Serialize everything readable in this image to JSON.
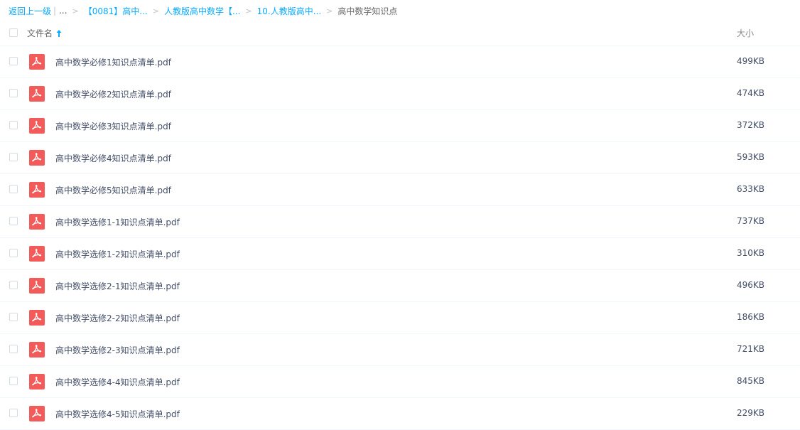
{
  "breadcrumb": {
    "back_label": "返回上一级",
    "ellipsis": "...",
    "items": [
      "【0081】高中...",
      "人教版高中数学【...",
      "10.人教版高中..."
    ],
    "current": "高中数学知识点",
    "separator": ">",
    "pipe": "|"
  },
  "header": {
    "name_col": "文件名",
    "size_col": "大小",
    "sort_icon": "arrow-up-icon"
  },
  "files": [
    {
      "name": "高中数学必修1知识点清单.pdf",
      "size": "499KB",
      "icon": "pdf-icon"
    },
    {
      "name": "高中数学必修2知识点清单.pdf",
      "size": "474KB",
      "icon": "pdf-icon"
    },
    {
      "name": "高中数学必修3知识点清单.pdf",
      "size": "372KB",
      "icon": "pdf-icon"
    },
    {
      "name": "高中数学必修4知识点清单.pdf",
      "size": "593KB",
      "icon": "pdf-icon"
    },
    {
      "name": "高中数学必修5知识点清单.pdf",
      "size": "633KB",
      "icon": "pdf-icon"
    },
    {
      "name": "高中数学选修1-1知识点清单.pdf",
      "size": "737KB",
      "icon": "pdf-icon"
    },
    {
      "name": "高中数学选修1-2知识点清单.pdf",
      "size": "310KB",
      "icon": "pdf-icon"
    },
    {
      "name": "高中数学选修2-1知识点清单.pdf",
      "size": "496KB",
      "icon": "pdf-icon"
    },
    {
      "name": "高中数学选修2-2知识点清单.pdf",
      "size": "186KB",
      "icon": "pdf-icon"
    },
    {
      "name": "高中数学选修2-3知识点清单.pdf",
      "size": "721KB",
      "icon": "pdf-icon"
    },
    {
      "name": "高中数学选修4-4知识点清单.pdf",
      "size": "845KB",
      "icon": "pdf-icon"
    },
    {
      "name": "高中数学选修4-5知识点清单.pdf",
      "size": "229KB",
      "icon": "pdf-icon"
    }
  ],
  "colors": {
    "link": "#09aaff",
    "pdf_red": "#f35a5a",
    "text": "#424e67"
  }
}
